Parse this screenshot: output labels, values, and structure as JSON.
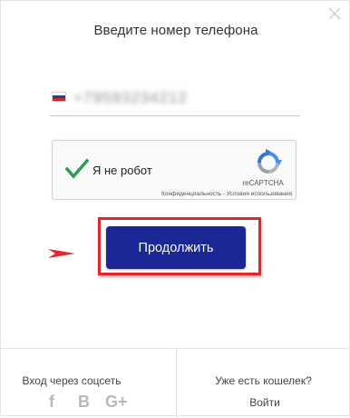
{
  "dialog": {
    "title": "Введите номер телефона",
    "close_icon": "close-icon"
  },
  "phone": {
    "country_flag": "russia-flag-icon",
    "value": "+79593234212"
  },
  "captcha": {
    "label": "Я не робот",
    "brand": "reCAPTCHA",
    "links": "Конфиденциальность - Условия использования",
    "check_color": "#2e9e4e"
  },
  "continue_button": {
    "label": "Продолжить",
    "color": "#1b2795",
    "highlight_color": "#e3262c"
  },
  "footer": {
    "social_title": "Вход через соцсеть",
    "social_icons": [
      {
        "name": "facebook-icon",
        "glyph": "f"
      },
      {
        "name": "vk-icon",
        "glyph": "В"
      },
      {
        "name": "google-plus-icon",
        "glyph": "G+"
      }
    ],
    "wallet_question": "Уже есть кошелек?",
    "login_label": "Войти"
  }
}
